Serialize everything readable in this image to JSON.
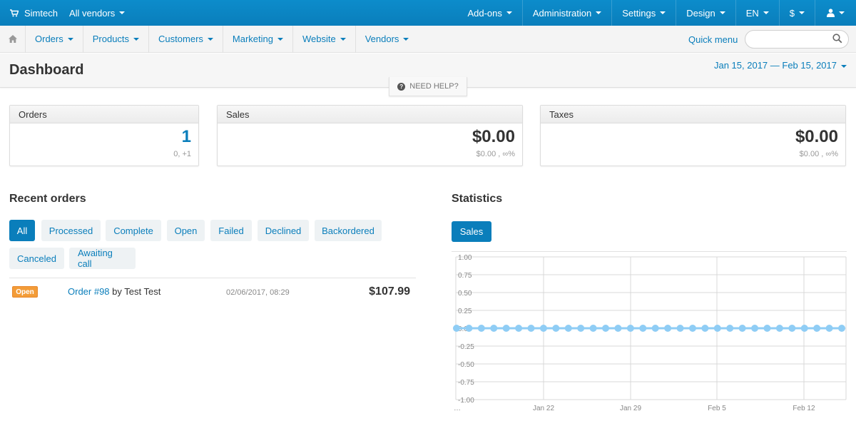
{
  "topbar": {
    "brand": "Simtech",
    "vendors": "All vendors",
    "menu": [
      "Add-ons",
      "Administration",
      "Settings",
      "Design",
      "EN",
      "$"
    ]
  },
  "nav": {
    "items": [
      "Orders",
      "Products",
      "Customers",
      "Marketing",
      "Website",
      "Vendors"
    ],
    "quick_menu": "Quick menu",
    "search_placeholder": ""
  },
  "header": {
    "title": "Dashboard",
    "date_range": "Jan 15, 2017 — Feb 15, 2017",
    "need_help": "NEED HELP?"
  },
  "cards": [
    {
      "title": "Orders",
      "value": "1",
      "sub": "0, +1"
    },
    {
      "title": "Sales",
      "value": "$0.00",
      "sub": "$0.00 , ∞%"
    },
    {
      "title": "Taxes",
      "value": "$0.00",
      "sub": "$0.00 , ∞%"
    }
  ],
  "recent_orders": {
    "title": "Recent orders",
    "filters": [
      "All",
      "Processed",
      "Complete",
      "Open",
      "Failed",
      "Declined",
      "Backordered",
      "Canceled",
      "Awaiting call"
    ],
    "active_filter": "All",
    "orders": [
      {
        "status": "Open",
        "link": "Order #98",
        "by": "by Test Test",
        "date": "02/06/2017, 08:29",
        "total": "$107.99"
      }
    ]
  },
  "statistics": {
    "title": "Statistics",
    "tab": "Sales"
  },
  "chart_data": {
    "type": "line",
    "series": [
      {
        "values": [
          0,
          0,
          0,
          0,
          0,
          0,
          0,
          0,
          0,
          0,
          0,
          0,
          0,
          0,
          0,
          0,
          0,
          0,
          0,
          0,
          0,
          0,
          0,
          0,
          0,
          0,
          0,
          0,
          0,
          0,
          0,
          0
        ]
      }
    ],
    "ylim": [
      -1.0,
      1.0
    ],
    "yticks": [
      "1.00",
      "0.75",
      "0.50",
      "0.25",
      "0.00",
      "-0.25",
      "-0.50",
      "-0.75",
      "-1.00"
    ],
    "xticks": [
      "…",
      "Jan 22",
      "Jan 29",
      "Feb 5",
      "Feb 12"
    ],
    "grid": true,
    "colors": {
      "line": "#8fcdf5",
      "grid": "#d8d8d8"
    }
  },
  "colors": {
    "accent": "#0a7ebb",
    "badge_open": "#f39c38"
  }
}
